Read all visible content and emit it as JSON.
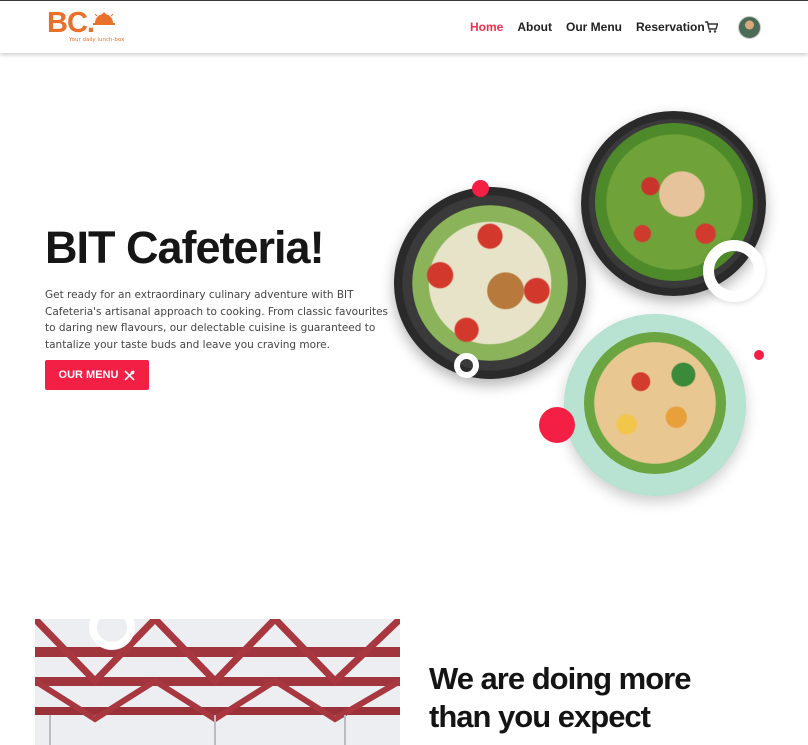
{
  "brand": {
    "logo_text": "BC.",
    "logo_tagline": "Your daily lunch-box",
    "accent_color": "#e8702a"
  },
  "nav": {
    "items": [
      {
        "label": "Home",
        "active": true
      },
      {
        "label": "About",
        "active": false
      },
      {
        "label": "Our Menu",
        "active": false
      },
      {
        "label": "Reservation",
        "active": false
      }
    ],
    "cart_icon": "cart-icon",
    "avatar_icon": "user-avatar",
    "active_color": "#f0304e"
  },
  "hero": {
    "title": "BIT Cafeteria!",
    "description": "Get ready for an extraordinary culinary adventure with BIT Cafeteria's artisanal approach to cooking. From classic favourites to daring new flavours, our delectable cuisine is guaranteed to tantalize your taste buds and leave you craving more.",
    "button_label": "OUR MENU",
    "button_icon": "utensils-icon",
    "button_color": "#f31f45"
  },
  "section2": {
    "title_line1": "We are doing more",
    "title_line2": "than you expect"
  }
}
